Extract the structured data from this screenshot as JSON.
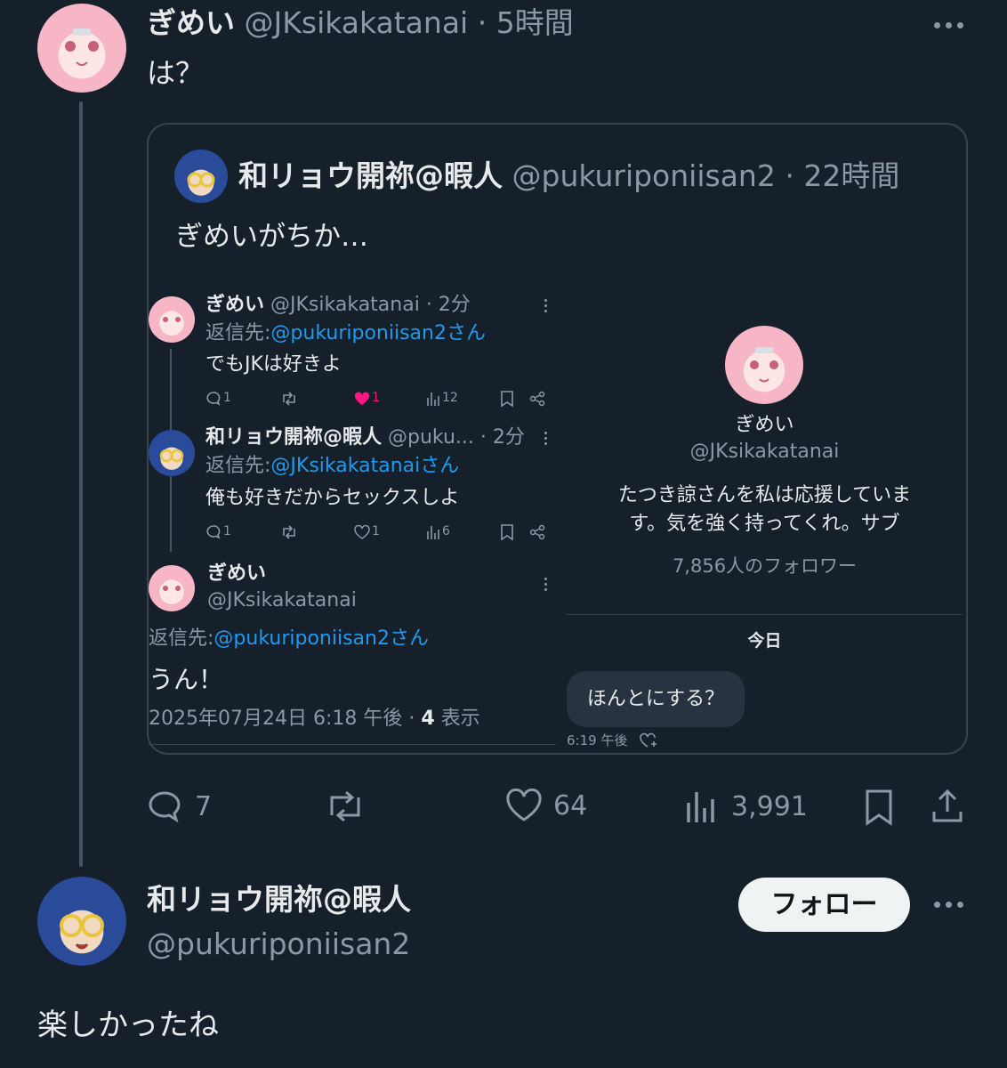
{
  "tweet": {
    "display_name": "ぎめい",
    "handle": "@JKsikakatanai",
    "sep": "·",
    "time": "5時間",
    "text": "は？"
  },
  "quote": {
    "display_name": "和リョウ開祢@暇人",
    "handle": "@pukuriponiisan2",
    "sep": "·",
    "time": "22時間",
    "text": "ぎめいがちか…",
    "screenshot": {
      "reply1": {
        "display_name": "ぎめい",
        "handle_time": "@JKsikakatanai · 2分",
        "reply_prefix": "返信先:",
        "reply_to": "@pukuriponiisan2さん",
        "text": "でもJKは好きよ",
        "replies": "1",
        "likes": "1",
        "views": "12"
      },
      "reply2": {
        "display_name": "和リョウ開祢@暇人",
        "handle_time": "@puku... · 2分",
        "reply_prefix": "返信先:",
        "reply_to": "@JKsikakatanaiさん",
        "text": "俺も好きだからセックスしよ",
        "replies": "1",
        "likes": "1",
        "views": "6"
      },
      "reply3": {
        "display_name": "ぎめい",
        "handle": "@JKsikakatanai",
        "reply_prefix": "返信先:",
        "reply_to": "@pukuriponiisan2さん",
        "text": "うん！",
        "timestamp": "2025年07月24日 6:18 午後 · ",
        "views": "4",
        "views_label": " 表示"
      },
      "profile": {
        "name": "ぎめい",
        "handle": "@JKsikakatanai",
        "bio_line1": "たつき諒さんを私は応援していま",
        "bio_line2": "す。気を強く持ってくれ。サブ",
        "followers": "7,856人のフォロワー",
        "date_label": "今日",
        "message": "ほんとにする？",
        "message_time": "6:19 午後"
      }
    }
  },
  "actions": {
    "replies": "7",
    "likes": "64",
    "views": "3,991"
  },
  "reply": {
    "display_name": "和リョウ開祢@暇人",
    "handle": "@pukuriponiisan2",
    "follow_label": "フォロー",
    "text": "楽しかったね"
  },
  "colors": {
    "background": "#15202b",
    "accent": "#1d9bf0",
    "like_active": "#f91880",
    "muted": "#8b98a5"
  }
}
